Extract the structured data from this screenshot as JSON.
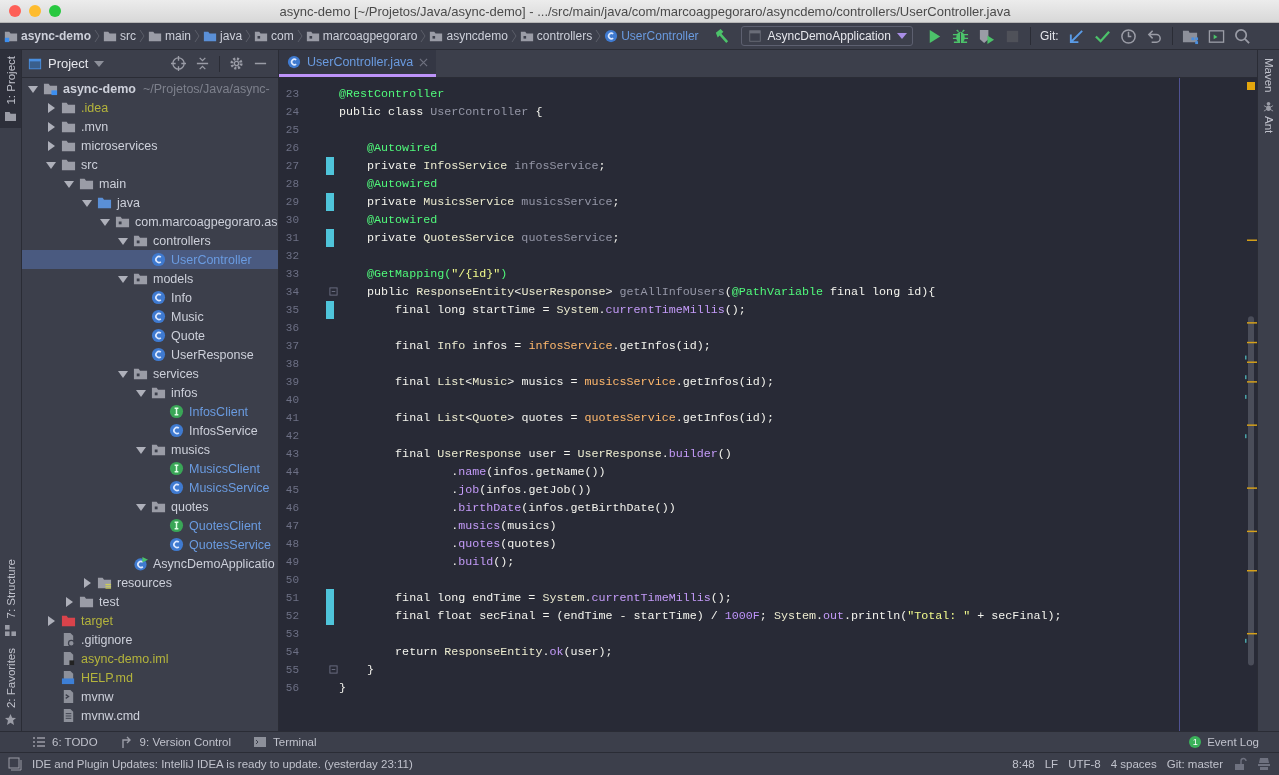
{
  "window": {
    "title": "async-demo [~/Projetos/Java/async-demo] - .../src/main/java/com/marcoagpegoraro/asyncdemo/controllers/UserController.java"
  },
  "breadcrumbs": [
    {
      "label": "async-demo",
      "kind": "module"
    },
    {
      "label": "src",
      "kind": "folder"
    },
    {
      "label": "main",
      "kind": "folder"
    },
    {
      "label": "java",
      "kind": "source"
    },
    {
      "label": "com",
      "kind": "package"
    },
    {
      "label": "marcoagpegoraro",
      "kind": "package"
    },
    {
      "label": "asyncdemo",
      "kind": "package"
    },
    {
      "label": "controllers",
      "kind": "package"
    },
    {
      "label": "UserController",
      "kind": "class"
    }
  ],
  "toolbar": {
    "run_config": "AsyncDemoApplication",
    "git_label": "Git:",
    "buttons": [
      {
        "kind": "build",
        "disabled": false
      },
      {
        "kind": "run",
        "disabled": false
      },
      {
        "kind": "debug",
        "disabled": false
      },
      {
        "kind": "coverage",
        "disabled": false
      },
      {
        "kind": "stop",
        "disabled": true
      }
    ],
    "git_buttons": [
      {
        "kind": "update",
        "disabled": false
      },
      {
        "kind": "commit",
        "disabled": false
      },
      {
        "kind": "history",
        "disabled": false
      },
      {
        "kind": "revert",
        "disabled": false
      },
      {
        "kind": "structure",
        "disabled": false
      },
      {
        "kind": "terminal",
        "disabled": false
      },
      {
        "kind": "search",
        "disabled": false
      }
    ]
  },
  "left_strip": [
    {
      "label": "1: Project",
      "selected": true,
      "kind": "project"
    },
    {
      "label": "7: Structure",
      "selected": false,
      "kind": "structure"
    },
    {
      "label": "2: Favorites",
      "selected": false,
      "kind": "favorites"
    }
  ],
  "project_panel": {
    "title": "Project",
    "tree": [
      {
        "label": "async-demo",
        "path": "~/Projetos/Java/async-",
        "kind": "module",
        "color": "#cdd0da",
        "selected": false,
        "expanded": true,
        "children": [
          {
            "label": ".idea",
            "kind": "folder",
            "color": "#b4b43c",
            "selected": false,
            "expanded": false
          },
          {
            "label": ".mvn",
            "kind": "folder",
            "color": "#cdd0da",
            "selected": false,
            "expanded": false
          },
          {
            "label": "microservices",
            "kind": "folder",
            "color": "#cdd0da",
            "selected": false,
            "expanded": false
          },
          {
            "label": "src",
            "kind": "folder",
            "color": "#cdd0da",
            "selected": false,
            "expanded": true,
            "children": [
              {
                "label": "main",
                "kind": "folder",
                "color": "#cdd0da",
                "selected": false,
                "expanded": true,
                "children": [
                  {
                    "label": "java",
                    "kind": "source",
                    "color": "#cdd0da",
                    "selected": false,
                    "expanded": true,
                    "children": [
                      {
                        "label": "com.marcoagpegoraro.as",
                        "kind": "package",
                        "color": "#cdd0da",
                        "selected": false,
                        "expanded": true,
                        "children": [
                          {
                            "label": "controllers",
                            "kind": "package",
                            "color": "#cdd0da",
                            "selected": false,
                            "expanded": true,
                            "children": [
                              {
                                "label": "UserController",
                                "kind": "class",
                                "color": "#6a9be0",
                                "selected": true
                              }
                            ]
                          },
                          {
                            "label": "models",
                            "kind": "package",
                            "color": "#cdd0da",
                            "selected": false,
                            "expanded": true,
                            "children": [
                              {
                                "label": "Info",
                                "kind": "class",
                                "color": "#cdd0da",
                                "selected": false
                              },
                              {
                                "label": "Music",
                                "kind": "class",
                                "color": "#cdd0da",
                                "selected": false
                              },
                              {
                                "label": "Quote",
                                "kind": "class",
                                "color": "#cdd0da",
                                "selected": false
                              },
                              {
                                "label": "UserResponse",
                                "kind": "class",
                                "color": "#cdd0da",
                                "selected": false
                              }
                            ]
                          },
                          {
                            "label": "services",
                            "kind": "package",
                            "color": "#cdd0da",
                            "selected": false,
                            "expanded": true,
                            "children": [
                              {
                                "label": "infos",
                                "kind": "package",
                                "color": "#cdd0da",
                                "selected": false,
                                "expanded": true,
                                "children": [
                                  {
                                    "label": "InfosClient",
                                    "kind": "interface",
                                    "color": "#6a9be0",
                                    "selected": false
                                  },
                                  {
                                    "label": "InfosService",
                                    "kind": "class",
                                    "color": "#cdd0da",
                                    "selected": false
                                  }
                                ]
                              },
                              {
                                "label": "musics",
                                "kind": "package",
                                "color": "#cdd0da",
                                "selected": false,
                                "expanded": true,
                                "children": [
                                  {
                                    "label": "MusicsClient",
                                    "kind": "interface",
                                    "color": "#6a9be0",
                                    "selected": false
                                  },
                                  {
                                    "label": "MusicsService",
                                    "kind": "class",
                                    "color": "#6a9be0",
                                    "selected": false
                                  }
                                ]
                              },
                              {
                                "label": "quotes",
                                "kind": "package",
                                "color": "#cdd0da",
                                "selected": false,
                                "expanded": true,
                                "children": [
                                  {
                                    "label": "QuotesClient",
                                    "kind": "interface",
                                    "color": "#6a9be0",
                                    "selected": false
                                  },
                                  {
                                    "label": "QuotesService",
                                    "kind": "class",
                                    "color": "#6a9be0",
                                    "selected": false
                                  }
                                ]
                              }
                            ]
                          },
                          {
                            "label": "AsyncDemoApplicatio",
                            "kind": "app",
                            "color": "#cdd0da",
                            "selected": false
                          }
                        ]
                      }
                    ]
                  },
                  {
                    "label": "resources",
                    "kind": "resources",
                    "color": "#cdd0da",
                    "selected": false,
                    "expanded": false
                  }
                ]
              },
              {
                "label": "test",
                "kind": "folder",
                "color": "#cdd0da",
                "selected": false,
                "expanded": false
              }
            ]
          },
          {
            "label": "target",
            "kind": "excluded",
            "color": "#b4b43c",
            "selected": false,
            "expanded": false
          },
          {
            "label": ".gitignore",
            "kind": "ignorefile",
            "color": "#cdd0da",
            "selected": false
          },
          {
            "label": "async-demo.iml",
            "kind": "iml",
            "color": "#b4b43c",
            "selected": false
          },
          {
            "label": "HELP.md",
            "kind": "markdown",
            "color": "#b4b43c",
            "selected": false
          },
          {
            "label": "mvnw",
            "kind": "script",
            "color": "#cdd0da",
            "selected": false
          },
          {
            "label": "mvnw.cmd",
            "kind": "text",
            "color": "#cdd0da",
            "selected": false
          }
        ]
      }
    ]
  },
  "editor": {
    "tabs": [
      {
        "label": "UserController.java",
        "selected": true
      }
    ],
    "lines": [
      {
        "no": "23",
        "changed": false,
        "fold": false,
        "tokens": [
          {
            "t": "@RestController",
            "kind": "ann"
          }
        ]
      },
      {
        "no": "24",
        "changed": false,
        "fold": false,
        "tokens": [
          {
            "t": "public class ",
            "kind": "kw"
          },
          {
            "t": "UserController",
            "kind": "unused"
          },
          {
            "t": " {",
            "kind": "plain"
          }
        ]
      },
      {
        "no": "25",
        "changed": false,
        "fold": false
      },
      {
        "no": "26",
        "changed": false,
        "fold": false,
        "tokens": [
          {
            "t": "    @Autowired",
            "kind": "ann"
          }
        ]
      },
      {
        "no": "27",
        "changed": true,
        "fold": false,
        "tokens": [
          {
            "t": "    private ",
            "kind": "kw"
          },
          {
            "t": "InfosService",
            "kind": "type"
          },
          {
            "t": " infosService",
            "kind": "field"
          },
          {
            "t": ";",
            "kind": "plain"
          }
        ]
      },
      {
        "no": "28",
        "changed": false,
        "fold": false,
        "tokens": [
          {
            "t": "    @Autowired",
            "kind": "ann"
          }
        ]
      },
      {
        "no": "29",
        "changed": true,
        "fold": false,
        "tokens": [
          {
            "t": "    private ",
            "kind": "kw"
          },
          {
            "t": "MusicsService",
            "kind": "type"
          },
          {
            "t": " musicsService",
            "kind": "field"
          },
          {
            "t": ";",
            "kind": "plain"
          }
        ]
      },
      {
        "no": "30",
        "changed": false,
        "fold": false,
        "tokens": [
          {
            "t": "    @Autowired",
            "kind": "ann"
          }
        ]
      },
      {
        "no": "31",
        "changed": true,
        "fold": false,
        "tokens": [
          {
            "t": "    private ",
            "kind": "kw"
          },
          {
            "t": "QuotesService",
            "kind": "type"
          },
          {
            "t": " quotesService",
            "kind": "field"
          },
          {
            "t": ";",
            "kind": "plain"
          }
        ]
      },
      {
        "no": "32",
        "changed": false,
        "fold": false
      },
      {
        "no": "33",
        "changed": false,
        "fold": false,
        "tokens": [
          {
            "t": "    @GetMapping(",
            "kind": "ann"
          },
          {
            "t": "\"/{id}\"",
            "kind": "str"
          },
          {
            "t": ")",
            "kind": "ann"
          }
        ]
      },
      {
        "no": "34",
        "changed": false,
        "fold": true,
        "tokens": [
          {
            "t": "    public ",
            "kind": "kw"
          },
          {
            "t": "ResponseEntity",
            "kind": "type"
          },
          {
            "t": "<",
            "kind": "plain"
          },
          {
            "t": "UserResponse",
            "kind": "type"
          },
          {
            "t": "> ",
            "kind": "plain"
          },
          {
            "t": "getAllInfoUsers",
            "kind": "unused"
          },
          {
            "t": "(",
            "kind": "plain"
          },
          {
            "t": "@PathVariable",
            "kind": "ann"
          },
          {
            "t": " final long ",
            "kind": "kw"
          },
          {
            "t": "id){",
            "kind": "plain"
          }
        ]
      },
      {
        "no": "35",
        "changed": true,
        "fold": false,
        "tokens": [
          {
            "t": "        final long ",
            "kind": "kw"
          },
          {
            "t": "startTime = ",
            "kind": "plain"
          },
          {
            "t": "System",
            "kind": "type"
          },
          {
            "t": ".",
            "kind": "plain"
          },
          {
            "t": "currentTimeMillis",
            "kind": "method"
          },
          {
            "t": "();",
            "kind": "plain"
          }
        ]
      },
      {
        "no": "36",
        "changed": false,
        "fold": false
      },
      {
        "no": "37",
        "changed": false,
        "fold": false,
        "tokens": [
          {
            "t": "        final ",
            "kind": "kw"
          },
          {
            "t": "Info",
            "kind": "type"
          },
          {
            "t": " infos = ",
            "kind": "plain"
          },
          {
            "t": "infosService",
            "kind": "fieldref"
          },
          {
            "t": ".getInfos(id);",
            "kind": "plain"
          }
        ]
      },
      {
        "no": "38",
        "changed": false,
        "fold": false
      },
      {
        "no": "39",
        "changed": false,
        "fold": false,
        "tokens": [
          {
            "t": "        final ",
            "kind": "kw"
          },
          {
            "t": "List",
            "kind": "type"
          },
          {
            "t": "<",
            "kind": "plain"
          },
          {
            "t": "Music",
            "kind": "type"
          },
          {
            "t": "> musics = ",
            "kind": "plain"
          },
          {
            "t": "musicsService",
            "kind": "fieldref"
          },
          {
            "t": ".getInfos(id);",
            "kind": "plain"
          }
        ]
      },
      {
        "no": "40",
        "changed": false,
        "fold": false
      },
      {
        "no": "41",
        "changed": false,
        "fold": false,
        "tokens": [
          {
            "t": "        final ",
            "kind": "kw"
          },
          {
            "t": "List",
            "kind": "type"
          },
          {
            "t": "<",
            "kind": "plain"
          },
          {
            "t": "Quote",
            "kind": "type"
          },
          {
            "t": "> quotes = ",
            "kind": "plain"
          },
          {
            "t": "quotesService",
            "kind": "fieldref"
          },
          {
            "t": ".getInfos(id);",
            "kind": "plain"
          }
        ]
      },
      {
        "no": "42",
        "changed": false,
        "fold": false
      },
      {
        "no": "43",
        "changed": false,
        "fold": false,
        "tokens": [
          {
            "t": "        final ",
            "kind": "kw"
          },
          {
            "t": "UserResponse",
            "kind": "type"
          },
          {
            "t": " user = ",
            "kind": "plain"
          },
          {
            "t": "UserResponse",
            "kind": "type"
          },
          {
            "t": ".",
            "kind": "plain"
          },
          {
            "t": "builder",
            "kind": "method"
          },
          {
            "t": "()",
            "kind": "plain"
          }
        ]
      },
      {
        "no": "44",
        "changed": false,
        "fold": false,
        "tokens": [
          {
            "t": "                .",
            "kind": "plain"
          },
          {
            "t": "name",
            "kind": "method"
          },
          {
            "t": "(infos.getName())",
            "kind": "plain"
          }
        ]
      },
      {
        "no": "45",
        "changed": false,
        "fold": false,
        "tokens": [
          {
            "t": "                .",
            "kind": "plain"
          },
          {
            "t": "job",
            "kind": "method"
          },
          {
            "t": "(infos.getJob())",
            "kind": "plain"
          }
        ]
      },
      {
        "no": "46",
        "changed": false,
        "fold": false,
        "tokens": [
          {
            "t": "                .",
            "kind": "plain"
          },
          {
            "t": "birthDate",
            "kind": "method"
          },
          {
            "t": "(infos.getBirthDate())",
            "kind": "plain"
          }
        ]
      },
      {
        "no": "47",
        "changed": false,
        "fold": false,
        "tokens": [
          {
            "t": "                .",
            "kind": "plain"
          },
          {
            "t": "musics",
            "kind": "method"
          },
          {
            "t": "(musics)",
            "kind": "plain"
          }
        ]
      },
      {
        "no": "48",
        "changed": false,
        "fold": false,
        "tokens": [
          {
            "t": "                .",
            "kind": "plain"
          },
          {
            "t": "quotes",
            "kind": "method"
          },
          {
            "t": "(quotes)",
            "kind": "plain"
          }
        ]
      },
      {
        "no": "49",
        "changed": false,
        "fold": false,
        "tokens": [
          {
            "t": "                .",
            "kind": "plain"
          },
          {
            "t": "build",
            "kind": "method"
          },
          {
            "t": "();",
            "kind": "plain"
          }
        ]
      },
      {
        "no": "50",
        "changed": false,
        "fold": false
      },
      {
        "no": "51",
        "changed": true,
        "fold": false,
        "tokens": [
          {
            "t": "        final long ",
            "kind": "kw"
          },
          {
            "t": "endTime = ",
            "kind": "plain"
          },
          {
            "t": "System",
            "kind": "type"
          },
          {
            "t": ".",
            "kind": "plain"
          },
          {
            "t": "currentTimeMillis",
            "kind": "method"
          },
          {
            "t": "();",
            "kind": "plain"
          }
        ]
      },
      {
        "no": "52",
        "changed": true,
        "fold": false,
        "tokens": [
          {
            "t": "        final float ",
            "kind": "kw"
          },
          {
            "t": "secFinal = (endTime - startTime) / ",
            "kind": "plain"
          },
          {
            "t": "1000F",
            "kind": "num"
          },
          {
            "t": "; ",
            "kind": "plain"
          },
          {
            "t": "System",
            "kind": "type"
          },
          {
            "t": ".",
            "kind": "plain"
          },
          {
            "t": "out",
            "kind": "method"
          },
          {
            "t": ".println(",
            "kind": "plain"
          },
          {
            "t": "\"Total: \"",
            "kind": "str"
          },
          {
            "t": " + secFinal);",
            "kind": "plain"
          }
        ]
      },
      {
        "no": "53",
        "changed": false,
        "fold": false
      },
      {
        "no": "54",
        "changed": false,
        "fold": false,
        "tokens": [
          {
            "t": "        return ",
            "kind": "kw"
          },
          {
            "t": "ResponseEntity",
            "kind": "type"
          },
          {
            "t": ".",
            "kind": "plain"
          },
          {
            "t": "ok",
            "kind": "method"
          },
          {
            "t": "(user);",
            "kind": "plain"
          }
        ]
      },
      {
        "no": "55",
        "changed": false,
        "fold": true,
        "tokens": [
          {
            "t": "    }",
            "kind": "plain"
          }
        ]
      },
      {
        "no": "56",
        "changed": false,
        "fold": false,
        "tokens": [
          {
            "t": "}",
            "kind": "plain"
          }
        ]
      }
    ]
  },
  "right_strip": [
    {
      "label": "Maven",
      "kind": "maven"
    },
    {
      "label": "Ant",
      "kind": "ant"
    }
  ],
  "tool_windows": [
    {
      "label": "6: TODO",
      "kind": "todo"
    },
    {
      "label": "9: Version Control",
      "kind": "vcs"
    },
    {
      "label": "Terminal",
      "kind": "terminal"
    }
  ],
  "event_log": {
    "label": "Event Log",
    "count": "1"
  },
  "status_bar": {
    "message": "IDE and Plugin Updates: IntelliJ IDEA is ready to update. (yesterday 23:11)",
    "items": [
      "8:48",
      "LF",
      "UTF-8",
      "4 spaces",
      "Git: master"
    ]
  }
}
